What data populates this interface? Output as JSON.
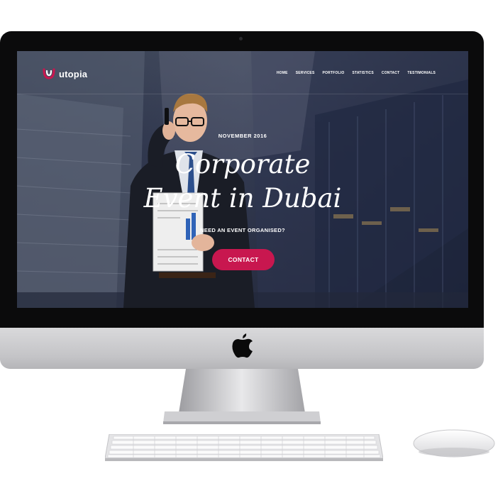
{
  "screen": {
    "logo_text": "utopia",
    "nav": [
      "HOME",
      "SERVICES",
      "PORTFOLIO",
      "STATISTICS",
      "CONTACT",
      "TESTIMONIALS"
    ],
    "hero": {
      "kicker": "NOVEMBER 2016",
      "title_line1": "Corporate",
      "title_line2": "Event in Dubai",
      "subtitle": "NEED AN EVENT ORGANISED?",
      "cta_label": "CONTACT"
    }
  },
  "colors": {
    "accent": "#c8174f",
    "bezel": "#0b0b0c",
    "chin": "#c9c9cc"
  }
}
